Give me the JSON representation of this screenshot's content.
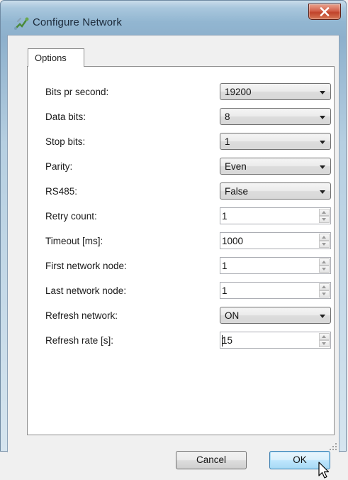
{
  "window": {
    "title": "Configure Network",
    "close_glyph": "X"
  },
  "tabs": [
    {
      "label": "Options"
    }
  ],
  "fields": [
    {
      "label": "Bits pr second:",
      "type": "combo",
      "value": "19200"
    },
    {
      "label": "Data bits:",
      "type": "combo",
      "value": "8"
    },
    {
      "label": "Stop bits:",
      "type": "combo",
      "value": "1"
    },
    {
      "label": "Parity:",
      "type": "combo",
      "value": "Even"
    },
    {
      "label": "RS485:",
      "type": "combo",
      "value": "False"
    },
    {
      "label": "Retry count:",
      "type": "spin",
      "value": "1"
    },
    {
      "label": "Timeout [ms]:",
      "type": "spin",
      "value": "1000"
    },
    {
      "label": "First network node:",
      "type": "spin",
      "value": "1"
    },
    {
      "label": "Last network node:",
      "type": "spin",
      "value": "1"
    },
    {
      "label": "Refresh network:",
      "type": "combo",
      "value": "ON"
    },
    {
      "label": "Refresh rate [s]:",
      "type": "spin",
      "value": "15"
    }
  ],
  "buttons": {
    "cancel": "Cancel",
    "ok": "OK"
  },
  "icons": {
    "app": "network-config-icon",
    "close": "close-icon",
    "dropdown": "chevron-down-icon",
    "spinner": "spinner-arrows-icon",
    "cursor": "mouse-pointer-icon"
  },
  "colors": {
    "close_button": "#c7442c",
    "ok_button_border": "#3c7fb1",
    "title_bar": "#9dbcd6"
  }
}
